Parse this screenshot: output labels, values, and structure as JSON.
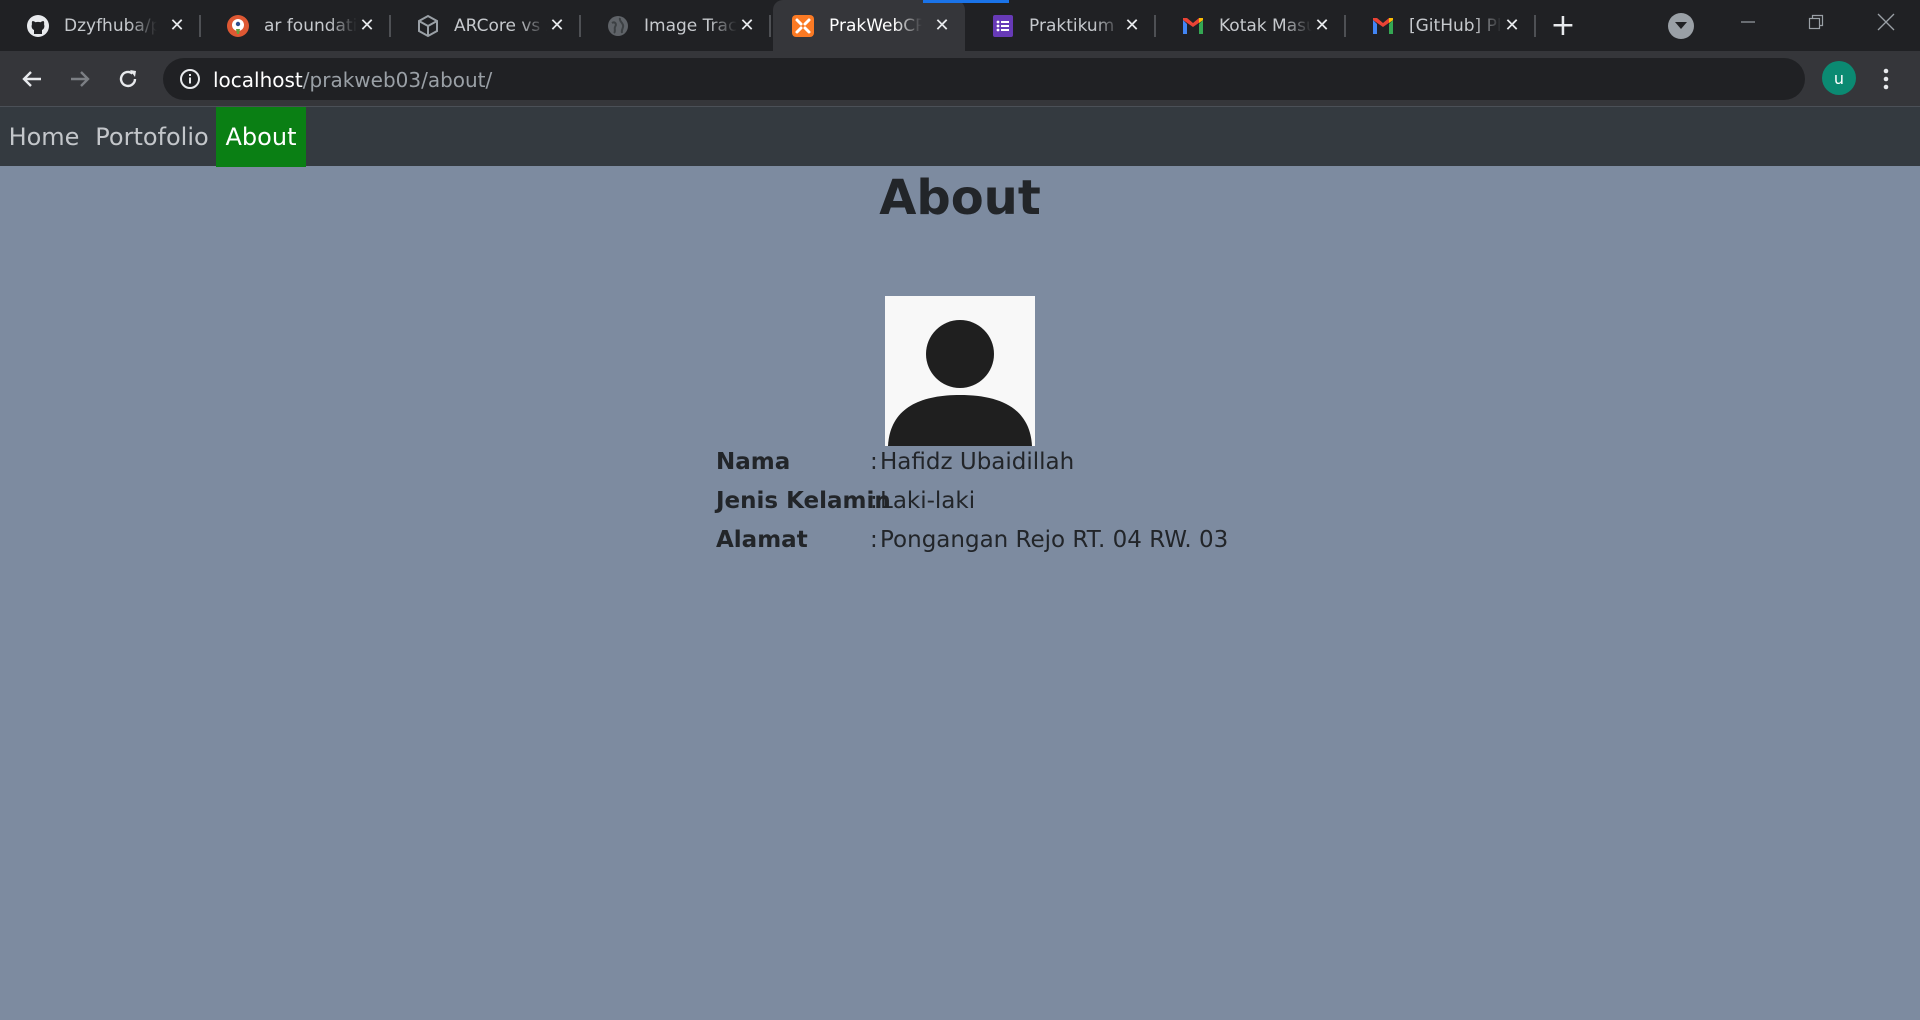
{
  "browser": {
    "tabs": [
      {
        "title": "Dzyfhuba/p",
        "icon": "github-icon"
      },
      {
        "title": "ar foundatic",
        "icon": "duckduckgo-icon"
      },
      {
        "title": "ARCore vs A",
        "icon": "unity-icon"
      },
      {
        "title": "Image Track",
        "icon": "globe-icon"
      },
      {
        "title": "PrakWebCP",
        "icon": "xampp-icon",
        "active": true
      },
      {
        "title": "Praktikum P",
        "icon": "google-forms-icon"
      },
      {
        "title": "Kotak Masu",
        "icon": "gmail-icon"
      },
      {
        "title": "[GitHub] Pl",
        "icon": "gmail-icon"
      }
    ],
    "address": {
      "host": "localhost",
      "path": "/prakweb03/about/"
    },
    "profile_initial": "u"
  },
  "nav": {
    "items": [
      {
        "label": "Home"
      },
      {
        "label": "Portofolio"
      },
      {
        "label": "About",
        "active": true
      }
    ]
  },
  "page": {
    "title": "About",
    "avatar_icon": "user-silhouette-icon",
    "info": [
      {
        "label": "Nama",
        "separator": ":",
        "value": "Hafidz Ubaidillah"
      },
      {
        "label": "Jenis Kelamin",
        "separator": ":",
        "value": "Laki-laki"
      },
      {
        "label": "Alamat",
        "separator": ":",
        "value": "Pongangan Rejo RT. 04 RW. 03"
      }
    ]
  },
  "colors": {
    "page_background": "#7d8ba0",
    "navbar": "#343a40",
    "nav_active": "#0a7f14",
    "tab_accent": "#1a73e8"
  }
}
